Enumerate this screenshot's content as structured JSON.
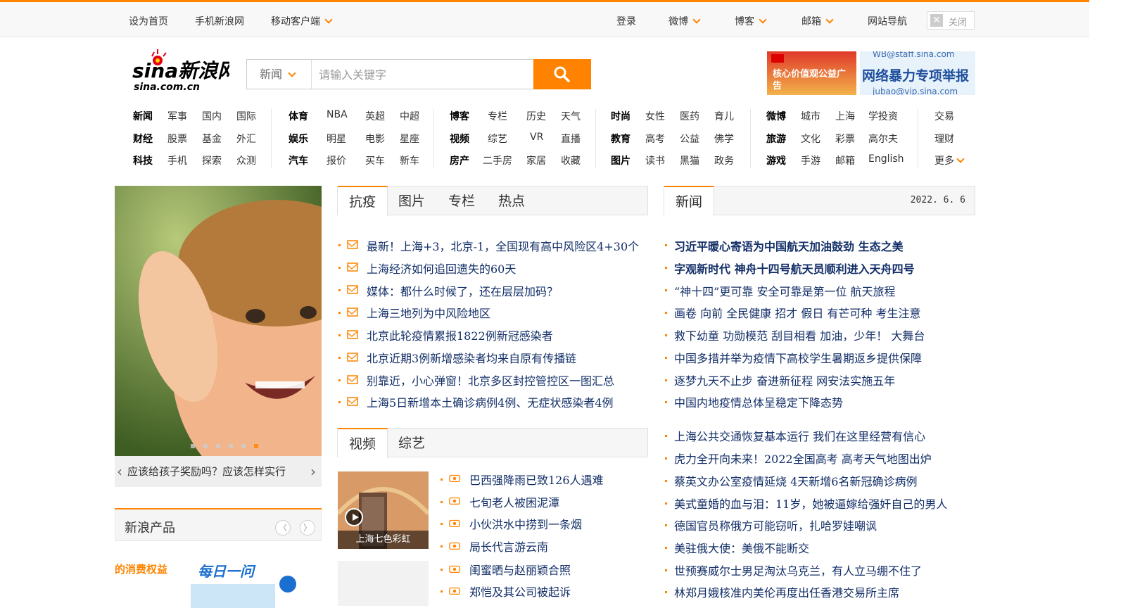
{
  "colors": {
    "accent": "#ff8400",
    "link": "#122e67",
    "search_button": "#ff8200"
  },
  "topbar": {
    "left": [
      "设为首页",
      "手机新浪网",
      "移动客户端"
    ],
    "right": [
      "登录",
      "微博",
      "博客",
      "邮箱",
      "网站导航"
    ],
    "close": "关闭"
  },
  "logo": {
    "brand": "sina新浪网",
    "domain": "sina.com.cn"
  },
  "search": {
    "category": "新闻",
    "placeholder": "请输入关键字",
    "button_icon": "search-icon"
  },
  "ads": {
    "left": "核心价值观公益广告",
    "right_title": "网络暴力专项举报",
    "right_email_top": "WB@staff.sina.com",
    "right_email_bottom": "jubao@vip.sina.com"
  },
  "nav": {
    "g1": [
      [
        "新闻",
        "军事",
        "国内",
        "国际"
      ],
      [
        "财经",
        "股票",
        "基金",
        "外汇"
      ],
      [
        "科技",
        "手机",
        "探索",
        "众测"
      ]
    ],
    "g2": [
      [
        "体育",
        "NBA",
        "英超",
        "中超"
      ],
      [
        "娱乐",
        "明星",
        "电影",
        "星座"
      ],
      [
        "汽车",
        "报价",
        "买车",
        "新车"
      ]
    ],
    "g3": [
      [
        "博客",
        "专栏",
        "历史",
        "天气"
      ],
      [
        "视频",
        "综艺",
        "VR",
        "直播"
      ],
      [
        "房产",
        "二手房",
        "家居",
        "收藏"
      ]
    ],
    "g4": [
      [
        "时尚",
        "女性",
        "医药",
        "育儿"
      ],
      [
        "教育",
        "高考",
        "公益",
        "佛学"
      ],
      [
        "图片",
        "读书",
        "黑猫",
        "政务"
      ]
    ],
    "g5": [
      [
        "微博",
        "城市",
        "上海",
        "学投资"
      ],
      [
        "旅游",
        "文化",
        "彩票",
        "高尔夫"
      ],
      [
        "游戏",
        "手游",
        "邮箱",
        "English"
      ]
    ],
    "g6": [
      "交易",
      "理财",
      "更多"
    ]
  },
  "slider": {
    "caption": "应该给孩子奖励吗？应该怎样实行"
  },
  "products": {
    "title": "新浪产品",
    "promo_left": "的消费权益",
    "promo_right": "每日一问"
  },
  "tabs1": [
    "抗疫",
    "图片",
    "专栏",
    "热点"
  ],
  "list1": [
    "最新！上海+3，北京-1，全国现有高中风险区4+30个",
    "上海经济如何追回遗失的60天",
    "媒体：都什么时候了，还在层层加码？",
    "上海三地列为中风险地区",
    "北京此轮疫情累报1822例新冠感染者",
    "北京近期3例新增感染者均来自原有传播链",
    "别靠近，小心弹窗！北京多区封控管控区一图汇总",
    "上海5日新增本土确诊病例4例、无症状感染者4例"
  ],
  "tabs2": [
    "视频",
    "综艺"
  ],
  "video": {
    "thumb_label": "上海七色彩虹"
  },
  "list2": [
    "巴西强降雨已致126人遇难",
    "七旬老人被困泥潭",
    "小伙洪水中捞到一条烟",
    "局长代言游云南",
    "闺蜜晒与赵丽颖合照",
    "郑恺及其公司被起诉"
  ],
  "news": {
    "title": "新闻",
    "date": "2022. 6. 6",
    "headlines": [
      "习近平暖心寄语为中国航天加油鼓劲 生态之美",
      "字观新时代 神舟十四号航天员顺利进入天舟四号"
    ],
    "items_a": [
      "“神十四”更可靠 安全可靠是第一位 航天旅程",
      "画卷 向前 全民健康 招才 假日 有芒可种 考生注意",
      "救下幼童 功勋模范 刮目相看 加油，少年！ 大舞台",
      "中国多措并举为疫情下高校学生暑期返乡提供保障",
      "逐梦九天不止步 奋进新征程 网安法实施五年",
      "中国内地疫情总体呈稳定下降态势"
    ],
    "items_b": [
      "上海公共交通恢复基本运行 我们在这里经营有信心",
      "虎力全开向未来！2022全国高考 高考天气地图出炉",
      "蔡英文办公室疫情延烧 4天新增6名新冠确诊病例",
      "美式童婚的血与泪：11岁，她被逼嫁给强奸自己的男人",
      "德国官员称俄方可能窃听，扎哈罗娃嘲讽",
      "美驻俄大使：美俄不能断交",
      "世预赛威尔士男足淘汰乌克兰，有人立马绷不住了",
      "林郑月娥核准内美伦再度出任香港交易所主席"
    ]
  }
}
